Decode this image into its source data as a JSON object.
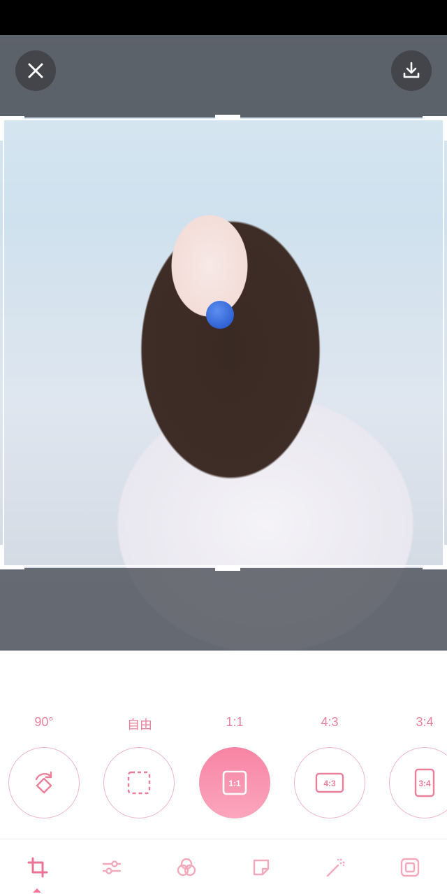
{
  "toolbar": {
    "close_icon": "close-icon",
    "download_icon": "download-icon"
  },
  "ratios": [
    {
      "label": "90°",
      "icon": "rotate-icon"
    },
    {
      "label": "自由",
      "icon": "free-crop-icon"
    },
    {
      "label": "1:1",
      "icon": "ratio-1-1-icon",
      "badge": "1:1",
      "selected": true
    },
    {
      "label": "4:3",
      "icon": "ratio-4-3-icon",
      "badge": "4:3"
    },
    {
      "label": "3:4",
      "icon": "ratio-3-4-icon",
      "badge": "3:4"
    }
  ],
  "bottom_tabs": [
    {
      "icon": "crop-icon",
      "selected": true
    },
    {
      "icon": "adjust-icon"
    },
    {
      "icon": "filter-icon"
    },
    {
      "icon": "sticker-icon"
    },
    {
      "icon": "magic-wand-icon"
    },
    {
      "icon": "frame-icon"
    }
  ],
  "colors": {
    "accent": "#f07896",
    "label": "#e8829c",
    "ring": "#f0b6c4"
  }
}
